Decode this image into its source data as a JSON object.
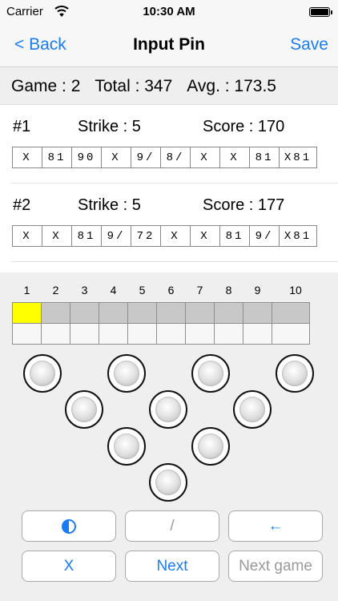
{
  "status_bar": {
    "carrier": "Carrier",
    "time": "10:30 AM"
  },
  "nav": {
    "back": "< Back",
    "title": "Input Pin",
    "save": "Save"
  },
  "summary": {
    "game": "Game : 2",
    "total": "Total : 347",
    "avg": "Avg. : 173.5"
  },
  "games": [
    {
      "num": "#1",
      "strike": "Strike : 5",
      "score": "Score : 170",
      "frames": [
        "X",
        "81",
        "90",
        "X",
        "9/",
        "8/",
        "X",
        "X",
        "81",
        "X81"
      ]
    },
    {
      "num": "#2",
      "strike": "Strike : 5",
      "score": "Score : 177",
      "frames": [
        "X",
        "X",
        "81",
        "9/",
        "72",
        "X",
        "X",
        "81",
        "9/",
        "X81"
      ]
    }
  ],
  "frame_numbers": [
    "1",
    "2",
    "3",
    "4",
    "5",
    "6",
    "7",
    "8",
    "9",
    "10"
  ],
  "active_frame": 1,
  "colors": {
    "accent": "#1a7cf5",
    "active_frame": "#ffff00",
    "disabled": "#9a9a9a"
  },
  "buttons": {
    "half": {
      "icon": "half-circle-icon"
    },
    "spare": "/",
    "back": "←",
    "strike": "X",
    "next": "Next",
    "next_game": "Next game"
  }
}
